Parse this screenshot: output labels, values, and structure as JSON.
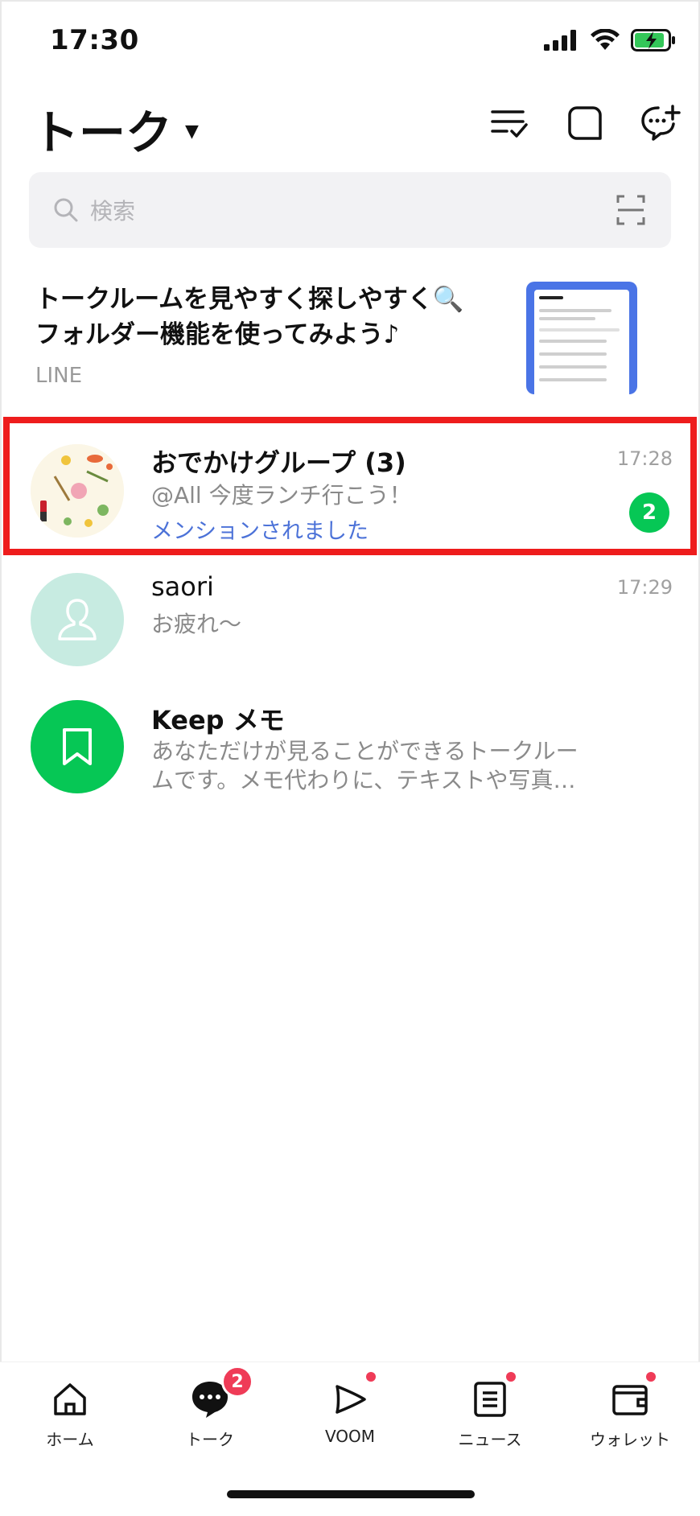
{
  "status_bar": {
    "time": "17:30"
  },
  "header": {
    "title": "トーク"
  },
  "search": {
    "placeholder": "検索"
  },
  "banner": {
    "title": "トークルームを見やすく探しやすく🔍 フォルダー機能を使ってみよう♪",
    "source": "LINE"
  },
  "chats": [
    {
      "name": "おでかけグループ (3)",
      "preview": "@All 今度ランチ行こう！",
      "mention": "メンションされました",
      "time": "17:28",
      "unread": "2"
    },
    {
      "name": "saori",
      "preview": "お疲れ〜",
      "time": "17:29"
    },
    {
      "name": "Keep メモ",
      "preview": "あなただけが見ることができるトークルームです。メモ代わりに、テキストや写真…"
    }
  ],
  "bottom_nav": {
    "items": [
      {
        "label": "ホーム",
        "icon": "home-icon"
      },
      {
        "label": "トーク",
        "icon": "chat-icon",
        "badge": "2"
      },
      {
        "label": "VOOM",
        "icon": "voom-icon"
      },
      {
        "label": "ニュース",
        "icon": "news-icon"
      },
      {
        "label": "ウォレット",
        "icon": "wallet-icon"
      }
    ]
  },
  "colors": {
    "accent_green": "#06c755",
    "badge_red": "#ef3b57",
    "mention_blue": "#4c72d8",
    "highlight_red": "#ee1c1c"
  }
}
